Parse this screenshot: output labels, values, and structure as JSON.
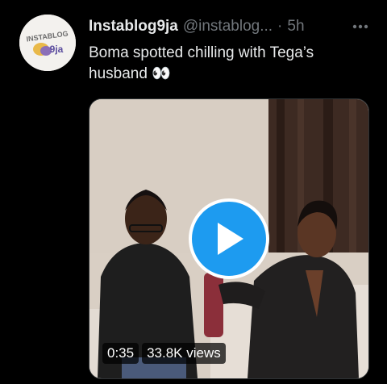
{
  "tweet": {
    "author_name": "Instablog9ja",
    "handle": "@instablog...",
    "separator": "·",
    "time": "5h",
    "text": "Boma spotted chilling with Tega’s husband 👀",
    "avatar_text_top": "INSTABLOG",
    "avatar_text_bottom": "9ja"
  },
  "video": {
    "duration": "0:35",
    "views": "33.8K views"
  },
  "icons": {
    "more": "more-horizontal-icon",
    "play": "play-icon"
  },
  "colors": {
    "background": "#000000",
    "text_primary": "#e7e9ea",
    "text_secondary": "#71767b",
    "accent": "#1d9bf0"
  }
}
